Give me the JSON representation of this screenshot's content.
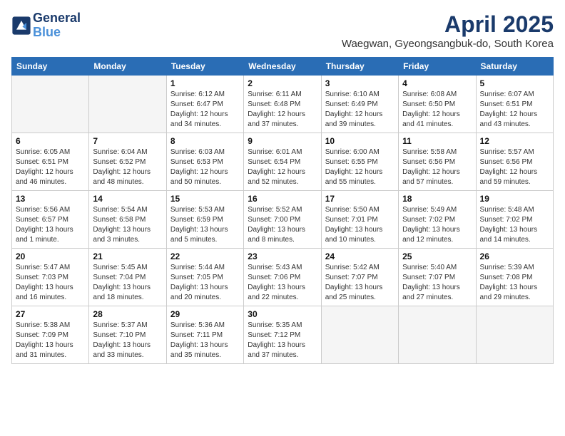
{
  "logo": {
    "line1": "General",
    "line2": "Blue"
  },
  "title": "April 2025",
  "location": "Waegwan, Gyeongsangbuk-do, South Korea",
  "days_header": [
    "Sunday",
    "Monday",
    "Tuesday",
    "Wednesday",
    "Thursday",
    "Friday",
    "Saturday"
  ],
  "weeks": [
    [
      {
        "day": "",
        "empty": true
      },
      {
        "day": "",
        "empty": true
      },
      {
        "day": "1",
        "sunrise": "6:12 AM",
        "sunset": "6:47 PM",
        "daylight": "12 hours and 34 minutes."
      },
      {
        "day": "2",
        "sunrise": "6:11 AM",
        "sunset": "6:48 PM",
        "daylight": "12 hours and 37 minutes."
      },
      {
        "day": "3",
        "sunrise": "6:10 AM",
        "sunset": "6:49 PM",
        "daylight": "12 hours and 39 minutes."
      },
      {
        "day": "4",
        "sunrise": "6:08 AM",
        "sunset": "6:50 PM",
        "daylight": "12 hours and 41 minutes."
      },
      {
        "day": "5",
        "sunrise": "6:07 AM",
        "sunset": "6:51 PM",
        "daylight": "12 hours and 43 minutes."
      }
    ],
    [
      {
        "day": "6",
        "sunrise": "6:05 AM",
        "sunset": "6:51 PM",
        "daylight": "12 hours and 46 minutes."
      },
      {
        "day": "7",
        "sunrise": "6:04 AM",
        "sunset": "6:52 PM",
        "daylight": "12 hours and 48 minutes."
      },
      {
        "day": "8",
        "sunrise": "6:03 AM",
        "sunset": "6:53 PM",
        "daylight": "12 hours and 50 minutes."
      },
      {
        "day": "9",
        "sunrise": "6:01 AM",
        "sunset": "6:54 PM",
        "daylight": "12 hours and 52 minutes."
      },
      {
        "day": "10",
        "sunrise": "6:00 AM",
        "sunset": "6:55 PM",
        "daylight": "12 hours and 55 minutes."
      },
      {
        "day": "11",
        "sunrise": "5:58 AM",
        "sunset": "6:56 PM",
        "daylight": "12 hours and 57 minutes."
      },
      {
        "day": "12",
        "sunrise": "5:57 AM",
        "sunset": "6:56 PM",
        "daylight": "12 hours and 59 minutes."
      }
    ],
    [
      {
        "day": "13",
        "sunrise": "5:56 AM",
        "sunset": "6:57 PM",
        "daylight": "13 hours and 1 minute."
      },
      {
        "day": "14",
        "sunrise": "5:54 AM",
        "sunset": "6:58 PM",
        "daylight": "13 hours and 3 minutes."
      },
      {
        "day": "15",
        "sunrise": "5:53 AM",
        "sunset": "6:59 PM",
        "daylight": "13 hours and 5 minutes."
      },
      {
        "day": "16",
        "sunrise": "5:52 AM",
        "sunset": "7:00 PM",
        "daylight": "13 hours and 8 minutes."
      },
      {
        "day": "17",
        "sunrise": "5:50 AM",
        "sunset": "7:01 PM",
        "daylight": "13 hours and 10 minutes."
      },
      {
        "day": "18",
        "sunrise": "5:49 AM",
        "sunset": "7:02 PM",
        "daylight": "13 hours and 12 minutes."
      },
      {
        "day": "19",
        "sunrise": "5:48 AM",
        "sunset": "7:02 PM",
        "daylight": "13 hours and 14 minutes."
      }
    ],
    [
      {
        "day": "20",
        "sunrise": "5:47 AM",
        "sunset": "7:03 PM",
        "daylight": "13 hours and 16 minutes."
      },
      {
        "day": "21",
        "sunrise": "5:45 AM",
        "sunset": "7:04 PM",
        "daylight": "13 hours and 18 minutes."
      },
      {
        "day": "22",
        "sunrise": "5:44 AM",
        "sunset": "7:05 PM",
        "daylight": "13 hours and 20 minutes."
      },
      {
        "day": "23",
        "sunrise": "5:43 AM",
        "sunset": "7:06 PM",
        "daylight": "13 hours and 22 minutes."
      },
      {
        "day": "24",
        "sunrise": "5:42 AM",
        "sunset": "7:07 PM",
        "daylight": "13 hours and 25 minutes."
      },
      {
        "day": "25",
        "sunrise": "5:40 AM",
        "sunset": "7:07 PM",
        "daylight": "13 hours and 27 minutes."
      },
      {
        "day": "26",
        "sunrise": "5:39 AM",
        "sunset": "7:08 PM",
        "daylight": "13 hours and 29 minutes."
      }
    ],
    [
      {
        "day": "27",
        "sunrise": "5:38 AM",
        "sunset": "7:09 PM",
        "daylight": "13 hours and 31 minutes."
      },
      {
        "day": "28",
        "sunrise": "5:37 AM",
        "sunset": "7:10 PM",
        "daylight": "13 hours and 33 minutes."
      },
      {
        "day": "29",
        "sunrise": "5:36 AM",
        "sunset": "7:11 PM",
        "daylight": "13 hours and 35 minutes."
      },
      {
        "day": "30",
        "sunrise": "5:35 AM",
        "sunset": "7:12 PM",
        "daylight": "13 hours and 37 minutes."
      },
      {
        "day": "",
        "empty": true
      },
      {
        "day": "",
        "empty": true
      },
      {
        "day": "",
        "empty": true
      }
    ]
  ]
}
